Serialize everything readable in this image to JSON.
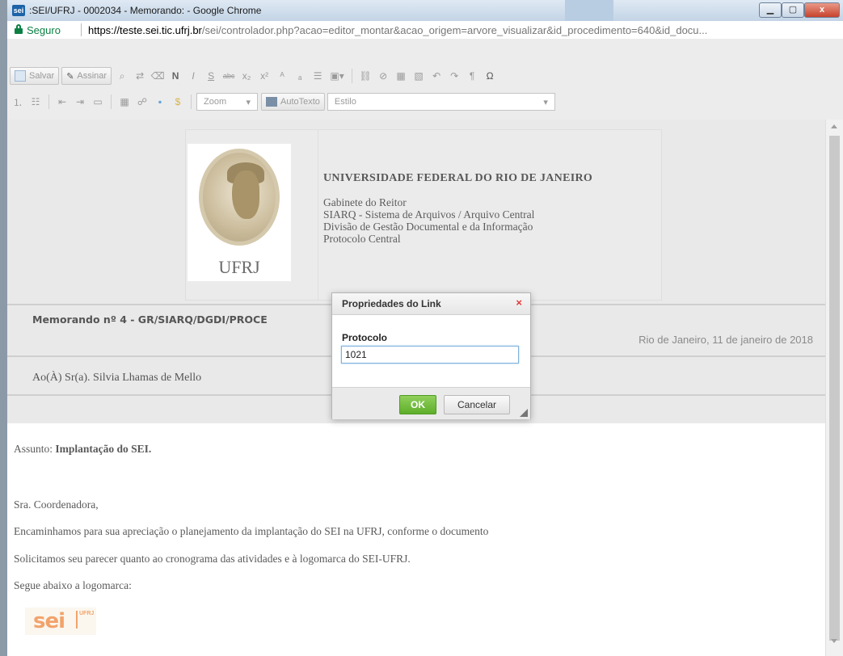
{
  "window": {
    "app_icon": "sei-icon",
    "title": ":SEI/UFRJ - 0002034 - Memorando: - Google Chrome",
    "minimize": "minimize-icon",
    "maximize": "maximize-icon",
    "close": "x"
  },
  "address": {
    "secure_label": "Seguro",
    "url_scheme_host": "https://teste.sei.tic.ufrj.br",
    "url_path": "/sei/controlador.php?acao=editor_montar&acao_origem=arvore_visualizar&id_procedimento=640&id_docu..."
  },
  "toolbar": {
    "save_label": "Salvar",
    "sign_label": "Assinar",
    "zoom_label": "Zoom",
    "autotext_label": "AutoTexto",
    "style_label": "Estilo",
    "bold_glyph": "N",
    "italic_glyph": "I",
    "underline_glyph": "S",
    "strike_glyph": "abc",
    "sub_glyph": "x₂",
    "sup_glyph": "x²",
    "omega_glyph": "Ω"
  },
  "document": {
    "logo_text": "UFRJ",
    "university": "UNIVERSIDADE FEDERAL DO RIO DE JANEIRO",
    "departments": [
      "Gabinete do Reitor",
      "SIARQ - Sistema de Arquivos / Arquivo Central",
      "Divisão de Gestão Documental e da Informação",
      "Protocolo Central"
    ],
    "memo_prefix": "Memorando nº 4 - GR/SIARQ/DGDI/PROCE",
    "date_line": "Rio de Janeiro, 11 de janeiro de 2018",
    "addressee": "Ao(À) Sr(a). Silvia Lhamas de Mello",
    "subject_label": "Assunto: ",
    "subject": "Implantação do SEI.",
    "greeting": "Sra. Coordenadora,",
    "para1": "Encaminhamos para sua apreciação o planejamento da implantação do SEI na UFRJ, conforme o documento",
    "para2": "Solicitamos seu parecer quanto ao cronograma das atividades e à logomarca do SEI-UFRJ.",
    "para3": "Segue abaixo a logomarca:",
    "sei_logo_text": "sei",
    "sei_logo_side": "UFRJ"
  },
  "dialog": {
    "title": "Propriedades do Link",
    "close": "×",
    "field_label": "Protocolo",
    "field_value": "1021",
    "ok_label": "OK",
    "cancel_label": "Cancelar"
  }
}
